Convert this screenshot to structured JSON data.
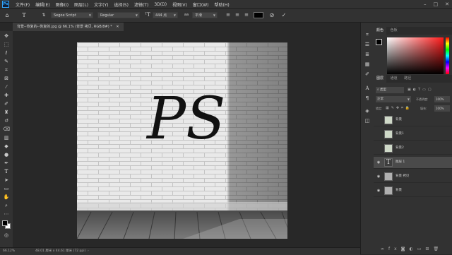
{
  "app": {
    "logo": "Ps"
  },
  "menubar": {
    "items": [
      "文件(F)",
      "编辑(E)",
      "图像(I)",
      "图层(L)",
      "文字(Y)",
      "选择(S)",
      "滤镜(T)",
      "3D(D)",
      "视图(V)",
      "窗口(W)",
      "帮助(H)"
    ]
  },
  "options": {
    "font_family": "Segoe Script",
    "font_style": "Regular",
    "font_size": "444 点",
    "anti_alias": "平滑"
  },
  "document": {
    "tab_title": "背景--恢复的--恢复的.jpg @ 66.1% (背景 拷贝, RGB/8#) *",
    "text": "PS"
  },
  "status": {
    "zoom": "66.12%",
    "doc_info": "48.01 厘米 x 44.61 厘米 (72 ppi)"
  },
  "color_panel": {
    "tabs": [
      "颜色",
      "色板"
    ]
  },
  "layers_panel": {
    "tabs": [
      "图层",
      "通道",
      "路径"
    ],
    "filter_placeholder": "类型",
    "blend_mode": "正常",
    "opacity_label": "不透明度:",
    "opacity_value": "100%",
    "lock_label": "锁定:",
    "fill_label": "填充:",
    "fill_value": "100%",
    "layers": [
      {
        "name": "背景",
        "visible": false,
        "thumb": "green"
      },
      {
        "name": "背景1",
        "visible": false,
        "thumb": "green"
      },
      {
        "name": "背景2",
        "visible": false,
        "thumb": "green"
      },
      {
        "name": "图层 1",
        "visible": true,
        "thumb": "text",
        "selected": true
      },
      {
        "name": "背景 拷贝",
        "visible": true,
        "thumb": "plain"
      },
      {
        "name": "背景",
        "visible": true,
        "thumb": "plain"
      }
    ]
  },
  "colors": {
    "accent": "#31a8ff",
    "foreground": "#000000",
    "background": "#ffffff"
  }
}
